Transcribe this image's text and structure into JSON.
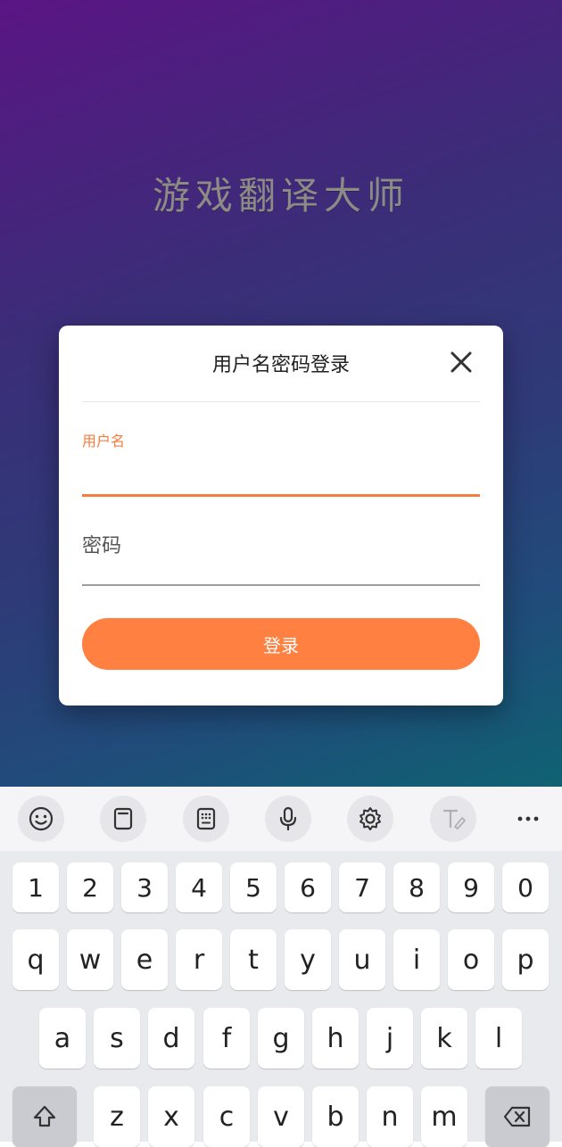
{
  "app": {
    "title": "游戏翻译大师"
  },
  "dialog": {
    "title": "用户名密码登录",
    "username_label": "用户名",
    "username_value": "",
    "password_placeholder": "密码",
    "password_value": "",
    "login_label": "登录",
    "accent_color": "#f47c3c",
    "button_color": "#ff8040"
  },
  "keyboard": {
    "toolbar": [
      "emoji-icon",
      "clipboard-icon",
      "keypad-icon",
      "microphone-icon",
      "settings-icon",
      "handwriting-icon",
      "more-icon"
    ],
    "row_numbers": [
      "1",
      "2",
      "3",
      "4",
      "5",
      "6",
      "7",
      "8",
      "9",
      "0"
    ],
    "row_1": [
      "q",
      "w",
      "e",
      "r",
      "t",
      "y",
      "u",
      "i",
      "o",
      "p"
    ],
    "row_2": [
      "a",
      "s",
      "d",
      "f",
      "g",
      "h",
      "j",
      "k",
      "l"
    ],
    "row_3": [
      "z",
      "x",
      "c",
      "v",
      "b",
      "n",
      "m"
    ]
  }
}
